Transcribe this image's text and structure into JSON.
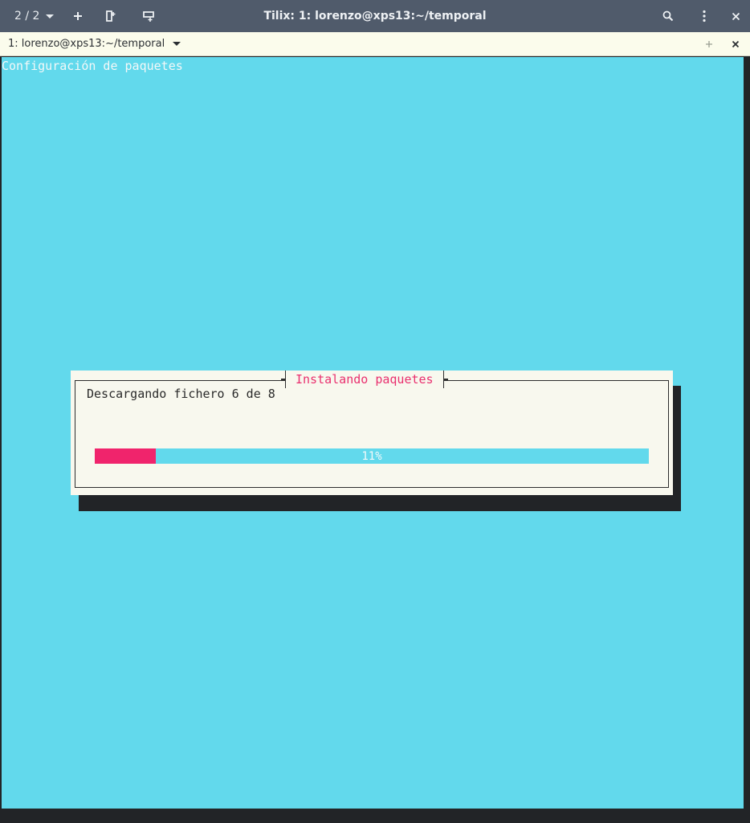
{
  "window": {
    "session_switcher": "2 / 2",
    "title": "Tilix: 1: lorenzo@xps13:~/temporal"
  },
  "tab": {
    "label": "1: lorenzo@xps13:~/temporal"
  },
  "terminal": {
    "backtitle": "Configuración de paquetes",
    "background_color": "#62d9ec",
    "dialog": {
      "title": "Instalando paquetes",
      "message": "Descargando fichero 6 de 8",
      "progress_text": "11%",
      "progress_fraction": 0.11,
      "accent_color": "#f0246c"
    }
  },
  "icons": {
    "session_dropdown": "chevron-down-icon",
    "add_terminal": "plus-icon",
    "split_right": "split-terminal-icon",
    "split_down": "split-down-icon",
    "search": "search-icon",
    "menu": "kebab-menu-icon",
    "close_window": "close-icon",
    "tab_add": "plus-icon",
    "tab_close": "close-icon"
  }
}
